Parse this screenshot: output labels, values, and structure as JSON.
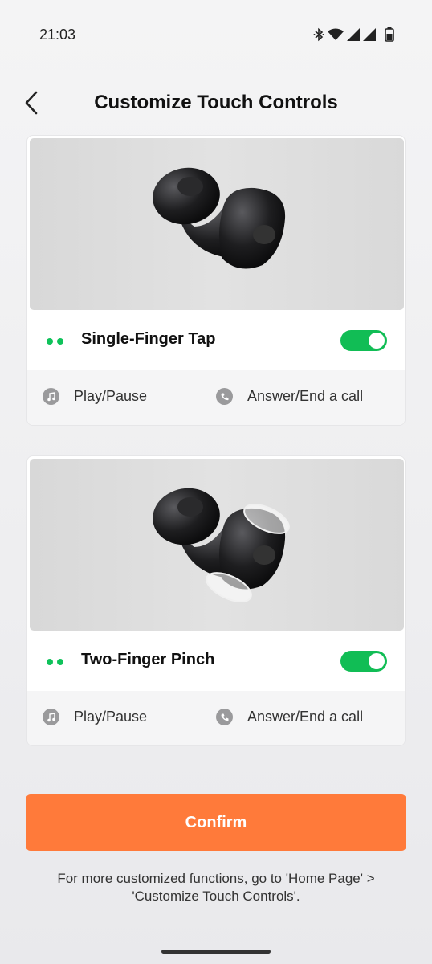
{
  "status_bar": {
    "time": "21:03",
    "icons": [
      "bluetooth-icon",
      "wifi-icon",
      "signal-icon",
      "signal-icon",
      "battery-icon"
    ]
  },
  "header": {
    "back_icon": "chevron-left-icon",
    "title": "Customize Touch Controls"
  },
  "cards": [
    {
      "gesture": "Single-Finger Tap",
      "toggle_on": true,
      "actions": [
        {
          "icon": "music-note-icon",
          "label": "Play/Pause"
        },
        {
          "icon": "phone-icon",
          "label": "Answer/End a call"
        }
      ]
    },
    {
      "gesture": "Two-Finger Pinch",
      "toggle_on": true,
      "actions": [
        {
          "icon": "music-note-icon",
          "label": "Play/Pause"
        },
        {
          "icon": "phone-icon",
          "label": "Answer/End a call"
        }
      ]
    }
  ],
  "confirm_label": "Confirm",
  "footer_note": "For more customized functions, go to 'Home Page' > 'Customize Touch Controls'.",
  "colors": {
    "accent_orange": "#ff7a3a",
    "toggle_green": "#11bd55",
    "dot_green": "#0fc25a"
  }
}
